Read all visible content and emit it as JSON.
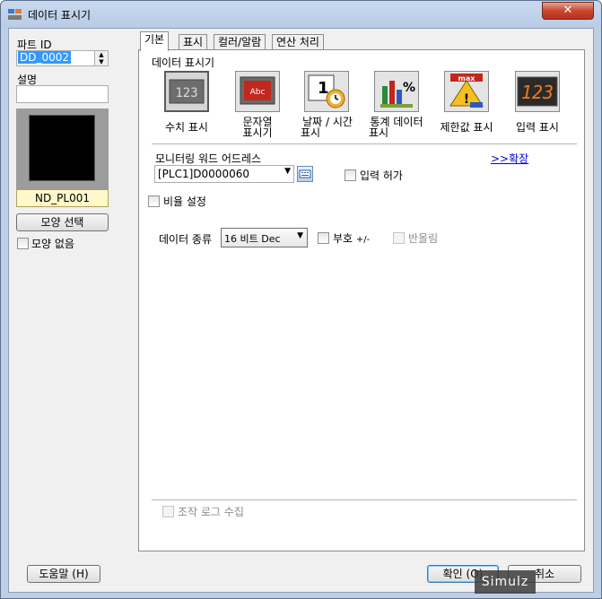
{
  "window": {
    "title": "데이터 표시기"
  },
  "left": {
    "part_id_label": "파트 ID",
    "part_id_value": "DD_0002",
    "desc_label": "설명",
    "desc_value": "",
    "shape_name": "ND_PL001",
    "shape_select_btn": "모양 선택",
    "no_shape_label": "모양 없음"
  },
  "tabs": [
    {
      "label": "기본"
    },
    {
      "label": "표시"
    },
    {
      "label": "컬러/알람"
    },
    {
      "label": "연산 처리"
    }
  ],
  "basic": {
    "section_title": "데이터 표시기",
    "types": [
      {
        "label": "수치 표시",
        "icon": "numeric-display-icon"
      },
      {
        "label": "문자열 표시기",
        "line1": "문자열",
        "line2": "표시기",
        "icon": "string-display-icon"
      },
      {
        "label": "날짜 / 시간 표시",
        "line1": "날짜 / 시간",
        "line2": "표시",
        "icon": "datetime-display-icon"
      },
      {
        "label": "통계 데이터 표시",
        "line1": "통계 데이터",
        "line2": "표시",
        "icon": "statistics-display-icon"
      },
      {
        "label": "제한값 표시",
        "icon": "limit-display-icon"
      },
      {
        "label": "입력 표시",
        "icon": "input-display-icon"
      }
    ],
    "monitor_label": "모니터링 워드 어드레스",
    "expand_link": ">>확장",
    "address_value": "[PLC1]D0000060",
    "input_allow_label": "입력 허가",
    "ratio_label": "비율 설정",
    "data_type_label": "데이터 종류",
    "data_type_value": "16 비트 Dec",
    "sign_label": "부호",
    "sign_suffix": "+/-",
    "rounding_label": "반올림",
    "op_log_label": "조작 로그 수집"
  },
  "footer": {
    "help_btn": "도움말 (H)",
    "ok_btn": "확인 (O)",
    "cancel_btn": "취소"
  },
  "watermark": "Simulz"
}
